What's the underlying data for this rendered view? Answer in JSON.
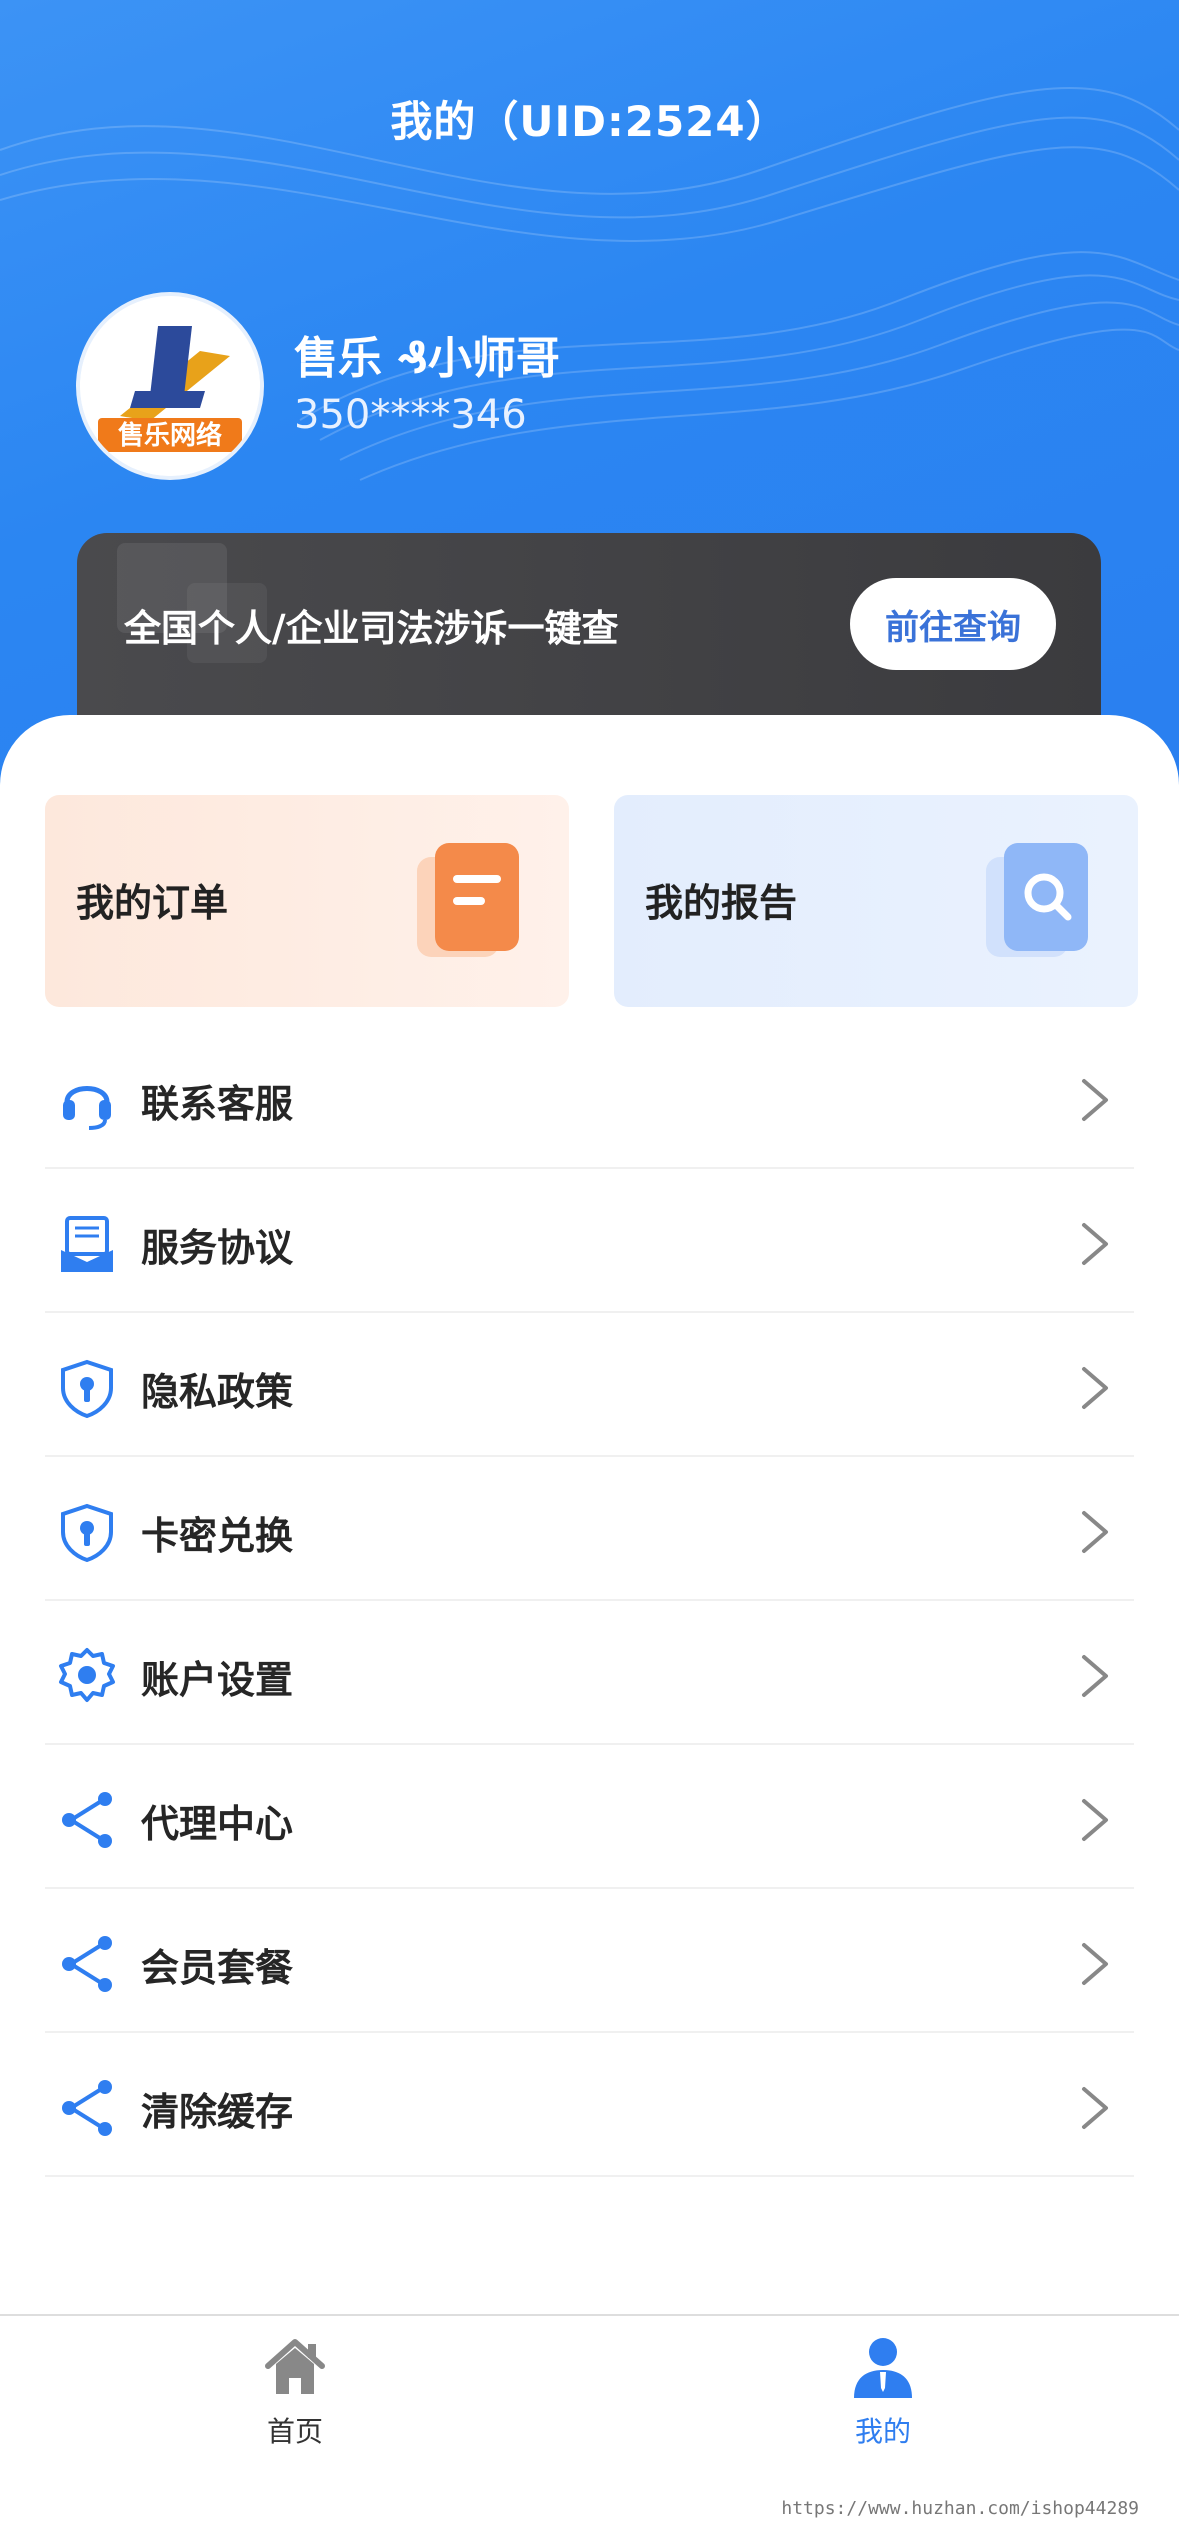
{
  "header": {
    "title": "我的（UID:2524）",
    "bg_color": "#2b86f2"
  },
  "profile": {
    "avatar_text": "售乐网络",
    "name": "售乐 ₰小师哥",
    "phone": "350****346"
  },
  "promo": {
    "text": "全国个人/企业司法涉诉一键查",
    "button_label": "前往查询"
  },
  "cards": {
    "orders_label": "我的订单",
    "reports_label": "我的报告"
  },
  "menu": {
    "items": [
      {
        "label": "联系客服",
        "icon": "headset-icon"
      },
      {
        "label": "服务协议",
        "icon": "document-icon"
      },
      {
        "label": "隐私政策",
        "icon": "shield-icon"
      },
      {
        "label": "卡密兑换",
        "icon": "shield-icon"
      },
      {
        "label": "账户设置",
        "icon": "gear-icon"
      },
      {
        "label": "代理中心",
        "icon": "share-icon"
      },
      {
        "label": "会员套餐",
        "icon": "share-icon"
      },
      {
        "label": "清除缓存",
        "icon": "share-icon"
      }
    ]
  },
  "tabbar": {
    "home_label": "首页",
    "mine_label": "我的",
    "active_color": "#2f7ef0"
  },
  "watermark": "https://www.huzhan.com/ishop44289"
}
